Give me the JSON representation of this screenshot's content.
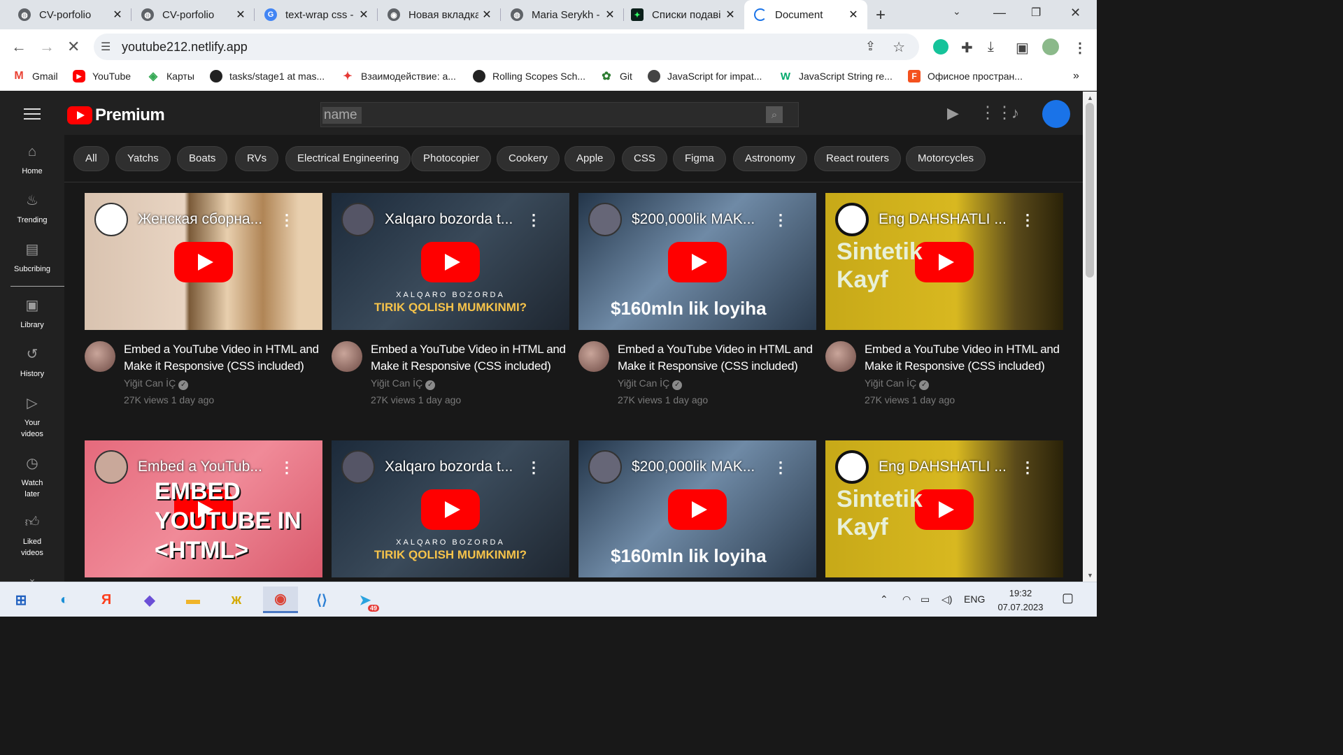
{
  "browser": {
    "tabs": [
      {
        "title": "CV-porfolio",
        "icon": "globe-icon",
        "color": "#5f6368"
      },
      {
        "title": "CV-porfolio",
        "icon": "globe-icon",
        "color": "#5f6368"
      },
      {
        "title": "text-wrap css -",
        "icon": "google-icon",
        "color": "#4285f4"
      },
      {
        "title": "Новая вкладка",
        "icon": "chrome-icon",
        "color": "#5f6368"
      },
      {
        "title": "Maria Serykh -",
        "icon": "globe-icon",
        "color": "#5f6368"
      },
      {
        "title": "Списки подаві",
        "icon": "sparkle-icon",
        "color": "#0b1f1a"
      },
      {
        "title": "Document",
        "icon": "loading-icon",
        "color": "#1a73e8"
      }
    ],
    "new_tab": "+",
    "url": "youtube212.netlify.app",
    "bookmarks": [
      {
        "label": "Gmail",
        "icon": "gmail-icon",
        "color": "#ea4335",
        "glyph": "M"
      },
      {
        "label": "YouTube",
        "icon": "youtube-icon",
        "color": "#ff0000",
        "glyph": "▶"
      },
      {
        "label": "Карты",
        "icon": "maps-icon",
        "color": "#34a853",
        "glyph": "●"
      },
      {
        "label": "tasks/stage1 at mas...",
        "icon": "github-icon",
        "color": "#222222",
        "glyph": "●"
      },
      {
        "label": "Взаимодействие: а...",
        "icon": "figure-icon",
        "color": "#e53935",
        "glyph": "✦"
      },
      {
        "label": "Rolling Scopes Sch...",
        "icon": "github-icon",
        "color": "#222222",
        "glyph": "●"
      },
      {
        "label": "Git",
        "icon": "git-icon",
        "color": "#2e7d32",
        "glyph": "✿"
      },
      {
        "label": "JavaScript for impat...",
        "icon": "globe-icon",
        "color": "#444444",
        "glyph": "●"
      },
      {
        "label": "JavaScript String re...",
        "icon": "w3-icon",
        "color": "#04aa6d",
        "glyph": "W"
      },
      {
        "label": "Офисное простран...",
        "icon": "office-icon",
        "color": "#f4511e",
        "glyph": "F"
      }
    ],
    "more_bookmarks": "»"
  },
  "youtube": {
    "logo_text": "Premium",
    "search_value": "name",
    "sidebar": [
      {
        "label": "Home",
        "icon": "home-icon"
      },
      {
        "label": "Trending",
        "icon": "flame-icon"
      },
      {
        "label": "Subcribing",
        "icon": "subscriptions-icon"
      },
      {
        "label": "Library",
        "icon": "library-icon"
      },
      {
        "label": "History",
        "icon": "history-icon"
      },
      {
        "label": "Your videos",
        "icon": "your-videos-icon"
      },
      {
        "label": "Watch later",
        "icon": "clock-icon"
      },
      {
        "label": "Liked videos",
        "icon": "thumbs-up-icon"
      }
    ],
    "chips": [
      "All",
      "Yatchs",
      "Boats",
      "RVs",
      "Electrical Engineering",
      "Photocopier",
      "Cookery",
      "Apple",
      "CSS",
      "Figma",
      "Astronomy",
      "React routers",
      "Motorcycles"
    ],
    "videos": [
      {
        "thumb_title": "Женская сборна...",
        "overlay": "",
        "title": "Embed a YouTube Video in HTML and Make it Responsive (CSS included)",
        "channel": "Yiğit Can İÇ",
        "stats": "27K views 1 day ago"
      },
      {
        "thumb_title": "Xalqaro bozorda t...",
        "overlay": "TIRIK QOLISH MUMKINMI?",
        "overlay_small": "XALQARO BOZORDA",
        "title": "Embed a YouTube Video in HTML and Make it Responsive (CSS included)",
        "channel": "Yiğit Can İÇ",
        "stats": "27K views 1 day ago"
      },
      {
        "thumb_title": "$200,000lik MAK...",
        "overlay": "$160mln lik loyiha",
        "title": "Embed a YouTube Video in HTML and Make it Responsive (CSS included)",
        "channel": "Yiğit Can İÇ",
        "stats": "27K views 1 day ago"
      },
      {
        "thumb_title": "Eng DAHSHATLI ...",
        "overlay": "Sintetik Kayf",
        "title": "Embed a YouTube Video in HTML and Make it Responsive (CSS included)",
        "channel": "Yiğit Can İÇ",
        "stats": "27K views 1 day ago"
      },
      {
        "thumb_title": "Embed a YouTub...",
        "overlay": "EMBED YOUTUBE IN <HTML>",
        "title": "",
        "channel": "",
        "stats": ""
      },
      {
        "thumb_title": "Xalqaro bozorda t...",
        "overlay": "TIRIK QOLISH MUMKINMI?",
        "overlay_small": "XALQARO BOZORDA",
        "title": "",
        "channel": "",
        "stats": ""
      },
      {
        "thumb_title": "$200,000lik MAK...",
        "overlay": "$160mln lik loyiha",
        "title": "",
        "channel": "",
        "stats": ""
      },
      {
        "thumb_title": "Eng DAHSHATLI ...",
        "overlay": "Sintetik Kayf",
        "title": "",
        "channel": "",
        "stats": ""
      }
    ]
  },
  "taskbar": {
    "lang": "ENG",
    "time": "19:32",
    "date": "07.07.2023",
    "telegram_badge": "49"
  }
}
